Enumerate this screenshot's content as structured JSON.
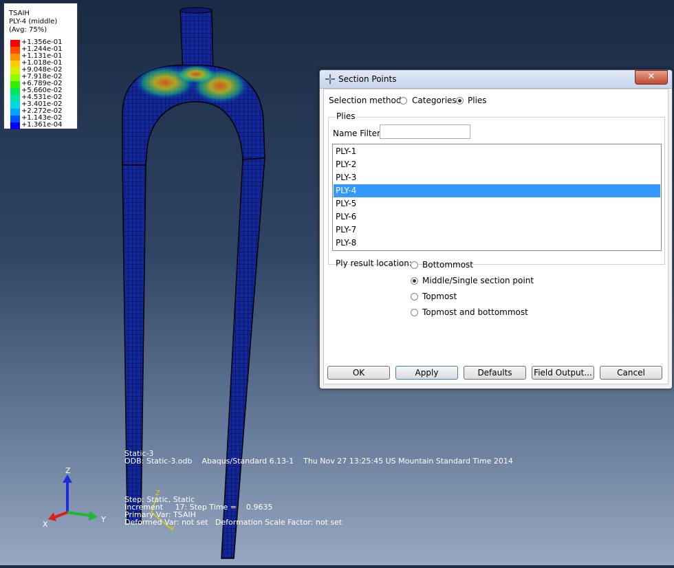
{
  "legend": {
    "title": "TSAIH",
    "subtitle": "PLY-4 (middle)",
    "avg": "(Avg: 75%)",
    "entries": [
      {
        "value": "+1.356e-01",
        "color": "#ff0000"
      },
      {
        "value": "+1.244e-01",
        "color": "#ff4a00"
      },
      {
        "value": "+1.131e-01",
        "color": "#ff8f00"
      },
      {
        "value": "+1.018e-01",
        "color": "#ffce00"
      },
      {
        "value": "+9.048e-02",
        "color": "#d8f000"
      },
      {
        "value": "+7.918e-02",
        "color": "#8cff00"
      },
      {
        "value": "+6.789e-02",
        "color": "#30f000"
      },
      {
        "value": "+5.660e-02",
        "color": "#00e85a"
      },
      {
        "value": "+4.531e-02",
        "color": "#00e6a8"
      },
      {
        "value": "+3.401e-02",
        "color": "#00d8e8"
      },
      {
        "value": "+2.272e-02",
        "color": "#00a0ff"
      },
      {
        "value": "+1.143e-02",
        "color": "#0050ff"
      },
      {
        "value": "+1.361e-04",
        "color": "#0000ff"
      }
    ]
  },
  "info": {
    "step_name": "Static-3",
    "odb_line": "ODB: Static-3.odb    Abaqus/Standard 6.13-1    Thu Nov 27 13:25:45 US Mountain Standard Time 2014",
    "step_line": "Step: Static, Static",
    "increment_line": "Increment     17: Step Time =    0.9635",
    "primary_line": "Primary Var: TSAIH",
    "deformed_line": "Deformed Var: not set   Deformation Scale Factor: not set"
  },
  "triad": {
    "x": "X",
    "y": "Y",
    "z": "Z"
  },
  "dialog": {
    "title": "Section Points",
    "close": "✕",
    "selection_method_label": "Selection method:",
    "categories_label": "Categories",
    "plies_label": "Plies",
    "group_label": "Plies",
    "name_filter_label": "Name Filter",
    "name_filter_value": "",
    "plies": [
      "PLY-1",
      "PLY-2",
      "PLY-3",
      "PLY-4",
      "PLY-5",
      "PLY-6",
      "PLY-7",
      "PLY-8"
    ],
    "selected_ply": "PLY-4",
    "ply_result_location_label": "Ply result location:",
    "locations": [
      "Bottommost",
      "Middle/Single section point",
      "Topmost",
      "Topmost and bottommost"
    ],
    "selected_location": "Middle/Single section point",
    "buttons": {
      "ok": "OK",
      "apply": "Apply",
      "defaults": "Defaults",
      "field_output": "Field Output...",
      "cancel": "Cancel"
    }
  },
  "colors": {
    "selection": "#3399ff",
    "mesh": "#0a1a6e"
  }
}
